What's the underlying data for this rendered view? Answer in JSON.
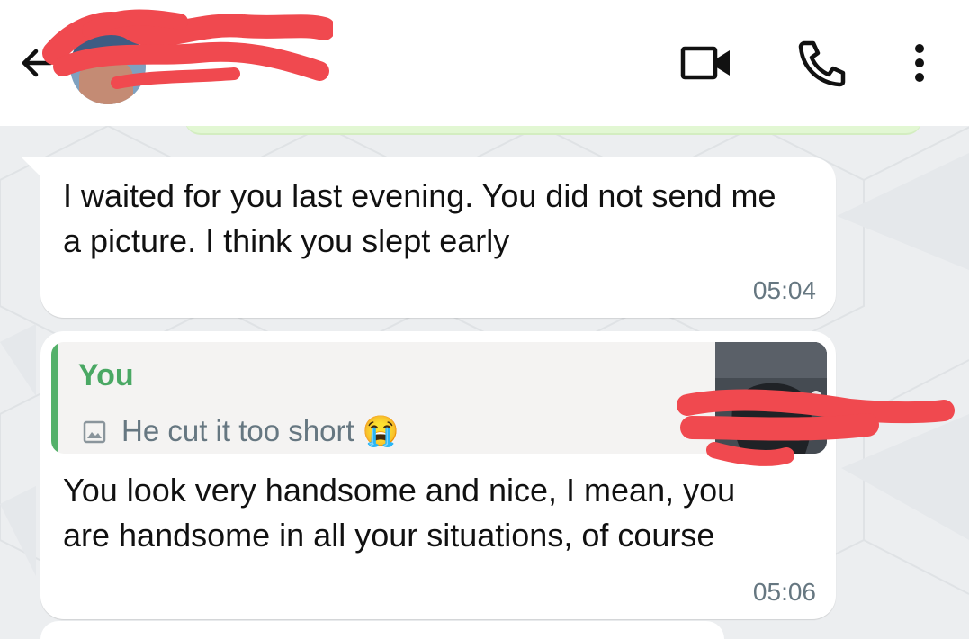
{
  "header": {
    "back_icon": "arrow-left-icon",
    "contact_name": "",
    "video_icon": "video-call-icon",
    "call_icon": "phone-icon",
    "menu_icon": "more-vert-icon"
  },
  "messages": [
    {
      "text": "I waited for you last evening. You did not send me a picture. I think you slept early",
      "time": "05:04"
    },
    {
      "quote_author": "You",
      "quote_text": "He cut it too short",
      "quote_emoji": "😭",
      "quote_icon": "image-icon",
      "text": "You look very handsome and nice, I mean, you are handsome in all your situations, of course",
      "time": "05:06"
    }
  ],
  "colors": {
    "accent_green": "#54b06a",
    "redaction": "#f0494f"
  }
}
